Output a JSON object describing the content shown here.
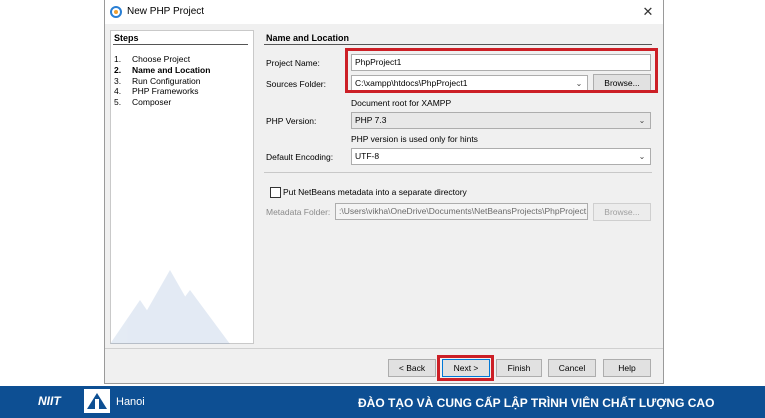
{
  "window": {
    "title": "New PHP Project",
    "close_glyph": "✕"
  },
  "steps": {
    "heading": "Steps",
    "items": [
      {
        "num": "1.",
        "label": "Choose Project",
        "current": false
      },
      {
        "num": "2.",
        "label": "Name and Location",
        "current": true
      },
      {
        "num": "3.",
        "label": "Run Configuration",
        "current": false
      },
      {
        "num": "4.",
        "label": "PHP Frameworks",
        "current": false
      },
      {
        "num": "5.",
        "label": "Composer",
        "current": false
      }
    ]
  },
  "form": {
    "heading": "Name and Location",
    "project_name_label": "Project Name:",
    "project_name_value": "PhpProject1",
    "sources_folder_label": "Sources Folder:",
    "sources_folder_value": "C:\\xampp\\htdocs\\PhpProject1",
    "browse_label": "Browse...",
    "document_root_hint": "Document root for XAMPP",
    "php_version_label": "PHP Version:",
    "php_version_value": "PHP 7.3",
    "php_version_hint": "PHP version is used only for hints",
    "encoding_label": "Default Encoding:",
    "encoding_value": "UTF-8",
    "metadata_checkbox_label": "Put NetBeans metadata into a separate directory",
    "metadata_checked": false,
    "metadata_folder_label": "Metadata Folder:",
    "metadata_folder_value": ":\\Users\\vikha\\OneDrive\\Documents\\NetBeansProjects\\PhpProject1",
    "metadata_browse_label": "Browse..."
  },
  "buttons": {
    "back": "< Back",
    "next": "Next >",
    "finish": "Finish",
    "cancel": "Cancel",
    "help": "Help"
  },
  "footer": {
    "logo_text": "NIIT",
    "logo_city": "Hanoi",
    "slogan": "ĐÀO TẠO VÀ CUNG CẤP LẬP TRÌNH VIÊN CHẤT LƯỢNG CAO"
  },
  "colors": {
    "highlight": "#cc1f26",
    "footer_bg": "#0d4f93"
  }
}
